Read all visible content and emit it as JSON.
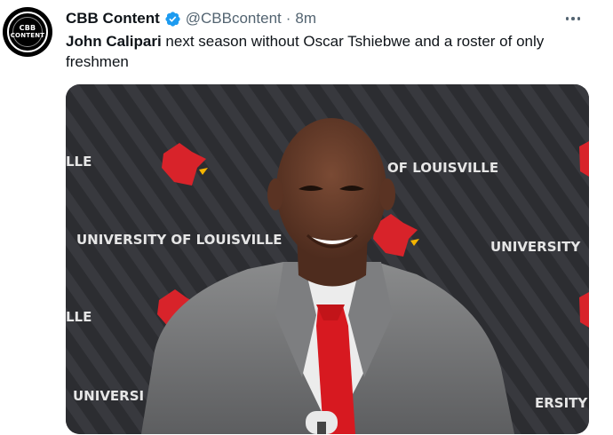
{
  "avatar": {
    "line1": "CBB",
    "line2": "CONTENT"
  },
  "author": {
    "display_name": "CBB Content",
    "handle": "@CBBcontent",
    "separator": "·",
    "time": "8m"
  },
  "tweet": {
    "bold_name": "John Calipari",
    "text_rest": " next season without Oscar Tshiebwe and a roster of only freshmen"
  },
  "media": {
    "backdrop_texts": [
      "LLE",
      "OF LOUISVILLE",
      "UNIVERSITY OF LOUISVILLE",
      "UNIVERSITY",
      "LLE",
      "UNIVERSI",
      "ERSITY"
    ]
  },
  "colors": {
    "verified_blue": "#1d9bf0",
    "muted_text": "#536471",
    "cardinal_red": "#d8232a"
  },
  "icons": {
    "verified": "verified-badge-icon",
    "more": "more-horizontal-icon"
  }
}
